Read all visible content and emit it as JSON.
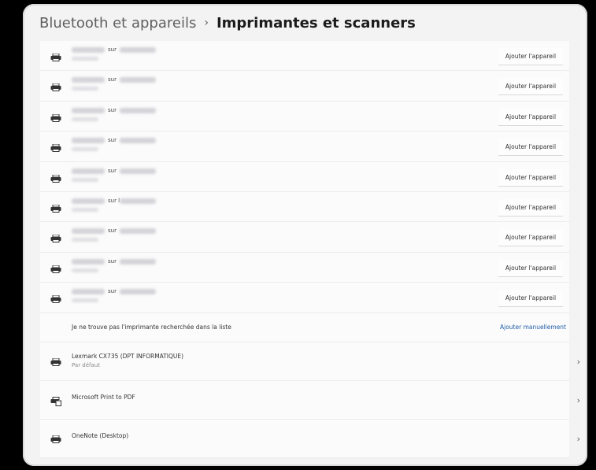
{
  "breadcrumb": {
    "parent": "Bluetooth et appareils",
    "separator": "›",
    "current": "Imprimantes et scanners"
  },
  "discovered_printers": [
    {
      "connector": "sur",
      "button_label": "Ajouter l'appareil"
    },
    {
      "connector": "sur",
      "button_label": "Ajouter l'appareil"
    },
    {
      "connector": "sur",
      "button_label": "Ajouter l'appareil"
    },
    {
      "connector": "sur",
      "button_label": "Ajouter l'appareil"
    },
    {
      "connector": "sur",
      "button_label": "Ajouter l'appareil"
    },
    {
      "connector": "sur l",
      "button_label": "Ajouter l'appareil"
    },
    {
      "connector": "sur",
      "button_label": "Ajouter l'appareil"
    },
    {
      "connector": "sur",
      "button_label": "Ajouter l'appareil"
    },
    {
      "connector": "sur",
      "button_label": "Ajouter l'appareil"
    }
  ],
  "manual": {
    "text": "Je ne trouve pas l'imprimante recherchée dans la liste",
    "link": "Ajouter manuellement"
  },
  "installed_printers": [
    {
      "name": "Lexmark CX735 (DPT INFORMATIQUE)",
      "subtitle": "Par défaut",
      "chevron": "›",
      "icon": "printer-icon"
    },
    {
      "name": "Microsoft Print to PDF",
      "subtitle": "",
      "chevron": "›",
      "icon": "pdf-printer-icon"
    },
    {
      "name": "OneNote (Desktop)",
      "subtitle": "",
      "chevron": "›",
      "icon": "printer-icon"
    }
  ]
}
